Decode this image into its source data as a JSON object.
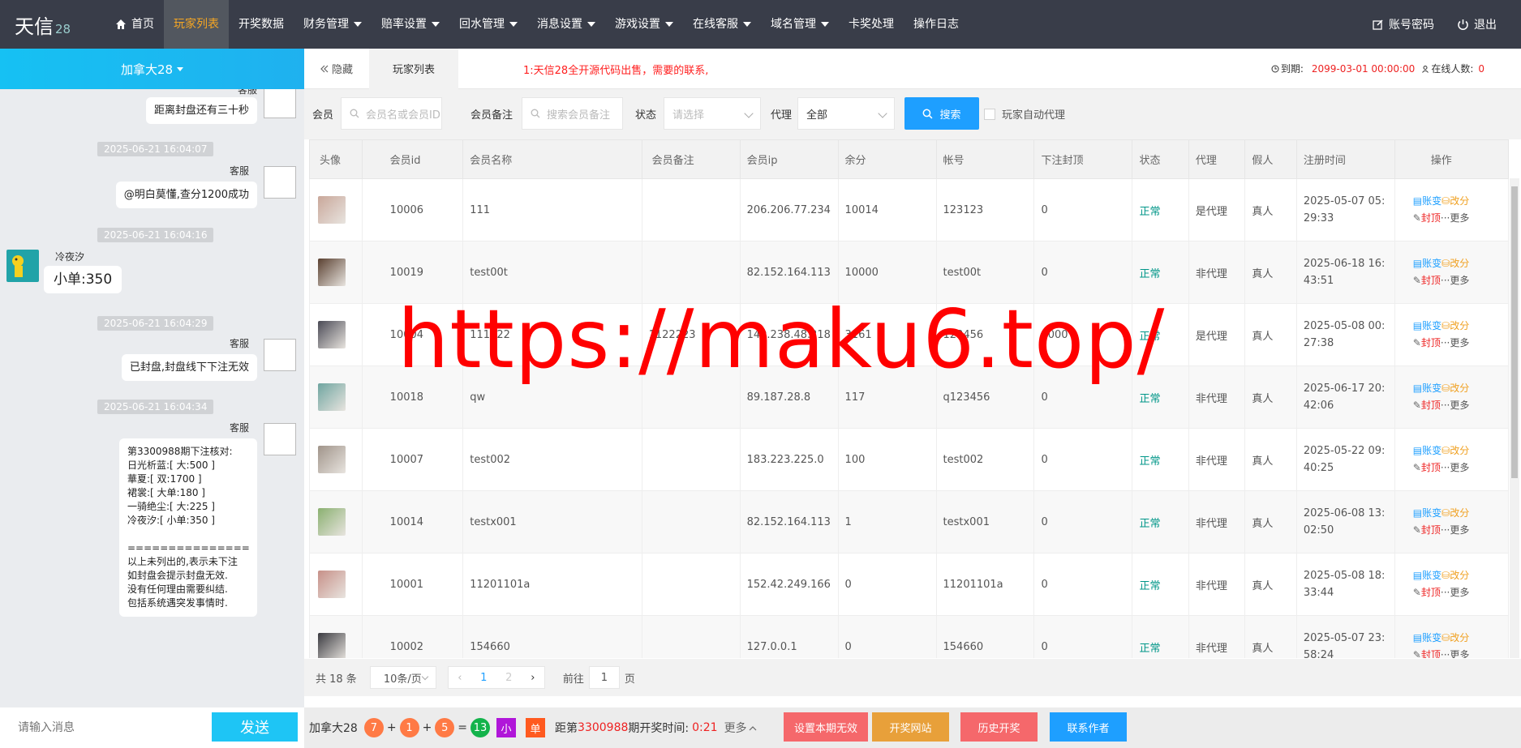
{
  "nav": {
    "logo": "天信",
    "logo_num": "28",
    "items": [
      {
        "label": "首页",
        "caret": false
      },
      {
        "label": "玩家列表",
        "caret": false,
        "active": true
      },
      {
        "label": "开奖数据",
        "caret": false
      },
      {
        "label": "财务管理",
        "caret": true
      },
      {
        "label": "赔率设置",
        "caret": true
      },
      {
        "label": "回水管理",
        "caret": true
      },
      {
        "label": "消息设置",
        "caret": true
      },
      {
        "label": "游戏设置",
        "caret": true
      },
      {
        "label": "在线客服",
        "caret": true
      },
      {
        "label": "域名管理",
        "caret": true
      },
      {
        "label": "卡奖处理",
        "caret": false
      },
      {
        "label": "操作日志",
        "caret": false
      }
    ],
    "account": "账号密码",
    "logout": "退出"
  },
  "left": {
    "room": "加拿大28",
    "top_name": "客服",
    "messages": [
      {
        "text": "距离封盘还有三十秒"
      },
      {
        "time": "2025-06-21 16:04:07",
        "name": "客服",
        "text": "@明白莫懂,查分1200成功"
      },
      {
        "time": "2025-06-21 16:04:16",
        "name": "冷夜汐",
        "text": "小单:350"
      },
      {
        "time": "2025-06-21 16:04:29",
        "name": "客服",
        "text": "已封盘,封盘线下下注无效"
      },
      {
        "time": "2025-06-21 16:04:34",
        "name": "客服",
        "lines": [
          "第3300988期下注核对:",
          "日光析蓝:[ 大:500 ]",
          "華夏:[ 双:1700 ]",
          "裙裳:[ 大单:180 ]",
          "一骑绝尘:[ 大:225 ]",
          "冷夜汐:[ 小单:350 ]",
          "",
          "===============",
          "以上未列出的,表示未下注",
          "如封盘会提示封盘无效.",
          "没有任何理由需要纠结.",
          "包括系统遇突发事情时."
        ]
      }
    ],
    "input_placeholder": "请输入消息",
    "send": "发送"
  },
  "tabs": {
    "hide": "隐藏",
    "active": "玩家列表"
  },
  "notice": "1:天信28全开源代码出售，需要的联系,",
  "expire": {
    "label": "到期:",
    "value": "2099-03-01 00:00:00",
    "online_label": "在线人数:",
    "online_value": "0"
  },
  "filters": {
    "member_label": "会员",
    "member_placeholder": "会员名或会员ID",
    "remark_label": "会员备注",
    "remark_placeholder": "搜索会员备注",
    "status_label": "状态",
    "status_placeholder": "请选择",
    "agent_label": "代理",
    "agent_value": "全部",
    "search": "搜索",
    "auto_agent": "玩家自动代理"
  },
  "table": {
    "headers": [
      "头像",
      "会员id",
      "会员名称",
      "会员备注",
      "会员ip",
      "余分",
      "帐号",
      "下注封顶",
      "状态",
      "代理",
      "假人",
      "注册时间",
      "操作"
    ],
    "rows": [
      {
        "id": "10006",
        "name": "111",
        "remark": "",
        "ip": "206.206.77.234",
        "score": "10014",
        "account": "123123",
        "cap": "0",
        "status": "正常",
        "agent": "是代理",
        "fake": "真人",
        "reg1": "2025-05-07 05:",
        "reg2": "29:33",
        "avatar": "#c9a79a"
      },
      {
        "id": "10019",
        "name": "test00t",
        "remark": "",
        "ip": "82.152.164.113",
        "score": "10000",
        "account": "test00t",
        "cap": "0",
        "status": "正常",
        "agent": "非代理",
        "fake": "真人",
        "reg1": "2025-06-18 16:",
        "reg2": "43:51",
        "avatar": "#5a4030"
      },
      {
        "id": "10004",
        "name": "111222",
        "remark": "1122223",
        "ip": "140.238.48.218",
        "score": "3161",
        "account": "123456",
        "cap": "1000",
        "status": "正常",
        "agent": "是代理",
        "fake": "真人",
        "reg1": "2025-05-08 00:",
        "reg2": "27:38",
        "avatar": "#4a4a55"
      },
      {
        "id": "10018",
        "name": "qw",
        "remark": "",
        "ip": "89.187.28.8",
        "score": "117",
        "account": "q123456",
        "cap": "0",
        "status": "正常",
        "agent": "非代理",
        "fake": "真人",
        "reg1": "2025-06-17 20:",
        "reg2": "42:06",
        "avatar": "#6fa5a0"
      },
      {
        "id": "10007",
        "name": "test002",
        "remark": "",
        "ip": "183.223.225.0",
        "score": "100",
        "account": "test002",
        "cap": "0",
        "status": "正常",
        "agent": "非代理",
        "fake": "真人",
        "reg1": "2025-05-22 09:",
        "reg2": "40:25",
        "avatar": "#a0948a"
      },
      {
        "id": "10014",
        "name": "testx001",
        "remark": "",
        "ip": "82.152.164.113",
        "score": "1",
        "account": "testx001",
        "cap": "0",
        "status": "正常",
        "agent": "非代理",
        "fake": "真人",
        "reg1": "2025-06-08 13:",
        "reg2": "02:50",
        "avatar": "#8ab070"
      },
      {
        "id": "10001",
        "name": "11201101a",
        "remark": "",
        "ip": "152.42.249.166",
        "score": "0",
        "account": "11201101a",
        "cap": "0",
        "status": "正常",
        "agent": "非代理",
        "fake": "真人",
        "reg1": "2025-05-08 18:",
        "reg2": "33:44",
        "avatar": "#c79088"
      },
      {
        "id": "10002",
        "name": "154660",
        "remark": "",
        "ip": "127.0.0.1",
        "score": "0",
        "account": "154660",
        "cap": "0",
        "status": "正常",
        "agent": "非代理",
        "fake": "真人",
        "reg1": "2025-05-07 23:",
        "reg2": "58:24",
        "avatar": "#3a3a40"
      }
    ],
    "ops": {
      "bill": "账变",
      "edit": "改分",
      "ban": "封顶",
      "more": "更多"
    }
  },
  "pager": {
    "total": "共 18 条",
    "per_page": "10条/页",
    "page1": "1",
    "page2": "2",
    "goto": "前往",
    "goto_value": "1",
    "page_unit": "页"
  },
  "bottom": {
    "room": "加拿大28",
    "n1": "7",
    "plus": "+",
    "n2": "1",
    "n3": "5",
    "eq": "=",
    "sum": "13",
    "size": "小",
    "parity": "单",
    "next_prefix": "距第",
    "period": "3300988",
    "next_suffix": "期开奖时间:",
    "countdown": "0:21",
    "more": "更多",
    "btn1": "设置本期无效",
    "btn2": "开奖网站",
    "btn3": "历史开奖",
    "btn4": "联系作者"
  },
  "watermark": "https://maku6.top/"
}
